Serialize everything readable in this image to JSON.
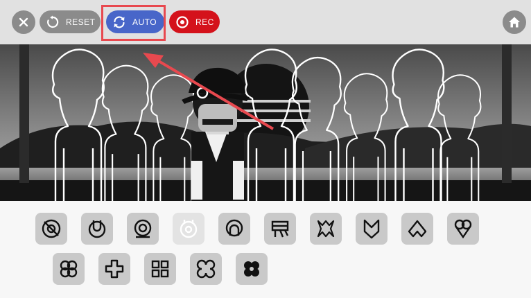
{
  "toolbar": {
    "close_icon": "close-x",
    "reset": {
      "label": "RESET",
      "icon": "rotate-ccw"
    },
    "auto": {
      "label": "AUTO",
      "icon": "sync-arrows"
    },
    "rec": {
      "label": "REC",
      "icon": "record-dot"
    },
    "home_icon": "house"
  },
  "palette": {
    "row1": [
      "beat-1",
      "beat-2",
      "beat-3",
      "beat-4",
      "effect-1",
      "effect-2",
      "effect-3",
      "melody-1",
      "melody-2",
      "melody-3"
    ],
    "row2": [
      "voice-1",
      "voice-2",
      "voice-3",
      "voice-4",
      "voice-5"
    ],
    "disabled": [
      "beat-4"
    ]
  },
  "colors": {
    "toolbar_bg": "#e1e1e1",
    "neutral_button": "#8b8b8b",
    "auto_button": "#4866c9",
    "rec_button": "#d4121b",
    "highlight": "#e8494f",
    "tile": "#c9c9c9"
  }
}
